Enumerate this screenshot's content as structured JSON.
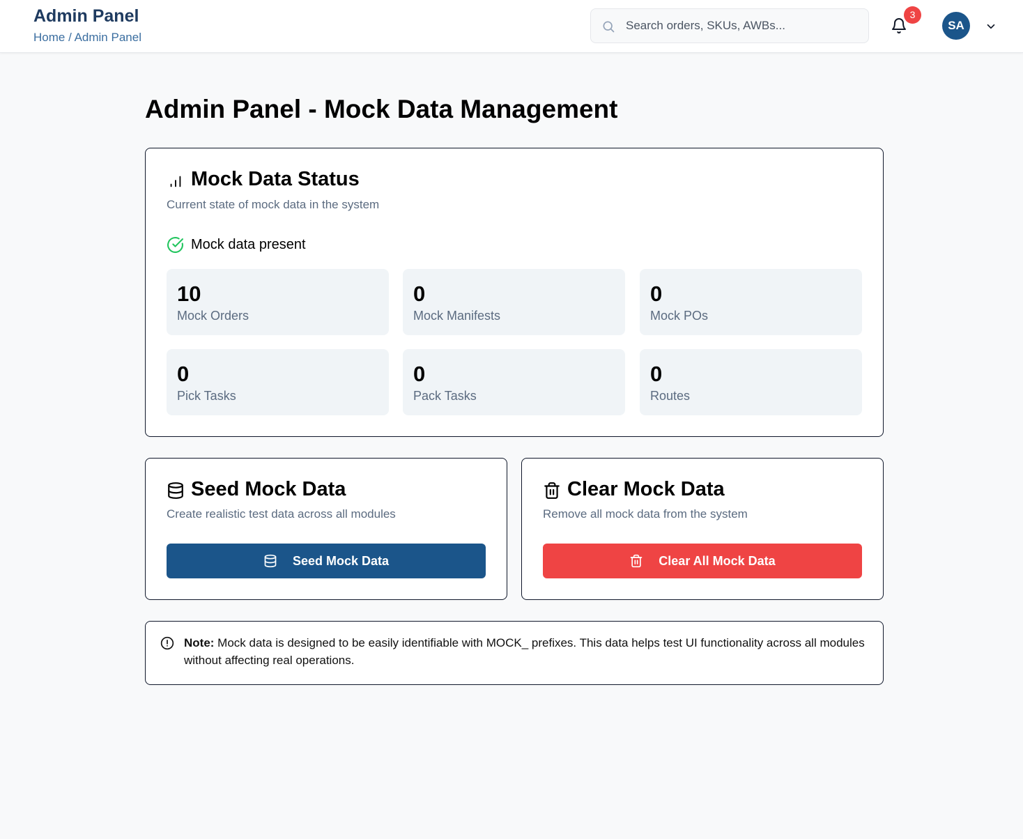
{
  "header": {
    "title": "Admin Panel",
    "breadcrumb": "Home / Admin Panel",
    "search_placeholder": "Search orders, SKUs, AWBs...",
    "notification_count": "3",
    "avatar_initials": "SA"
  },
  "page": {
    "title": "Admin Panel - Mock Data Management"
  },
  "status_card": {
    "icon": "bar-chart-icon",
    "title": "Mock Data Status",
    "subtitle": "Current state of mock data in the system",
    "status_text": "Mock data present",
    "status_color": "#22c55e",
    "stats": [
      {
        "value": "10",
        "label": "Mock Orders"
      },
      {
        "value": "0",
        "label": "Mock Manifests"
      },
      {
        "value": "0",
        "label": "Mock POs"
      },
      {
        "value": "0",
        "label": "Pick Tasks"
      },
      {
        "value": "0",
        "label": "Pack Tasks"
      },
      {
        "value": "0",
        "label": "Routes"
      }
    ]
  },
  "seed_card": {
    "icon": "database-icon",
    "title": "Seed Mock Data",
    "subtitle": "Create realistic test data across all modules",
    "button_label": "Seed Mock Data",
    "button_color": "#1b558a"
  },
  "clear_card": {
    "icon": "trash-icon",
    "title": "Clear Mock Data",
    "subtitle": "Remove all mock data from the system",
    "button_label": "Clear All Mock Data",
    "button_color": "#ef4444"
  },
  "note": {
    "label": "Note:",
    "text": " Mock data is designed to be easily identifiable with MOCK_ prefixes. This data helps test UI functionality across all modules without affecting real operations."
  }
}
